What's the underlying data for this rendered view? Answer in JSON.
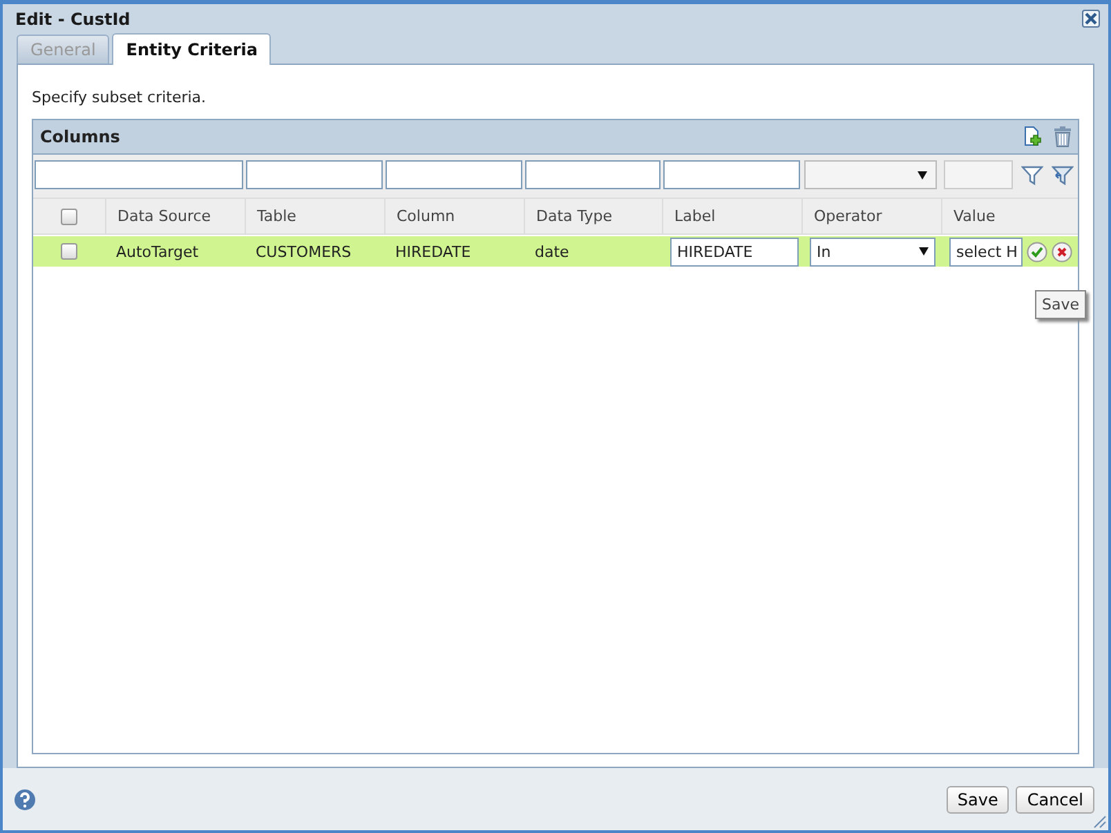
{
  "window": {
    "title": "Edit - CustId"
  },
  "tabs": [
    {
      "label": "General",
      "selected": false
    },
    {
      "label": "Entity Criteria",
      "selected": true
    }
  ],
  "instructions": "Specify subset criteria.",
  "panel": {
    "title": "Columns"
  },
  "table": {
    "columns": [
      {
        "label": "Data Source"
      },
      {
        "label": "Table"
      },
      {
        "label": "Column"
      },
      {
        "label": "Data Type"
      },
      {
        "label": "Label"
      },
      {
        "label": "Operator"
      },
      {
        "label": "Value"
      }
    ],
    "header_checked": false,
    "rows": [
      {
        "checked": false,
        "selected": true,
        "data_source": "AutoTarget",
        "table": "CUSTOMERS",
        "column": "HIREDATE",
        "data_type": "date",
        "label": "HIREDATE",
        "operator": "In",
        "value": "select H"
      }
    ]
  },
  "tooltip": "Save",
  "buttons": [
    {
      "label": "Save"
    },
    {
      "label": "Cancel"
    }
  ]
}
